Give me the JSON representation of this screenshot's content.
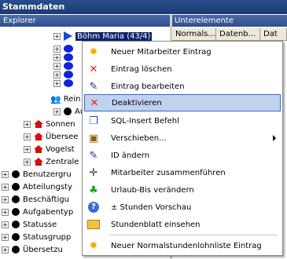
{
  "window": {
    "title": "Stammdaten"
  },
  "explorer": {
    "header": "Explorer"
  },
  "unterelemente": {
    "header": "Unterelemente",
    "columns": [
      "Normals...",
      "Datenb...",
      "Dat"
    ]
  },
  "tree": {
    "selected_employee": "Böhm Maria (43/4)",
    "partial_items": [
      "Rein",
      "Aufg"
    ],
    "departments": [
      "Sonnen",
      "Übersee",
      "Vogelst",
      "Zentrale"
    ],
    "categories": [
      "Benutzergru",
      "Abteilungsty",
      "Beschäftigu",
      "Aufgabentyp",
      "Statusse",
      "Statusgrupp",
      "Übersetzu"
    ]
  },
  "context_menu": {
    "items": [
      {
        "label": "Neuer Mitarbeiter Eintrag",
        "icon": "sun-icon"
      },
      {
        "label": "Eintrag löschen",
        "icon": "red-x-icon"
      },
      {
        "label": "Eintrag bearbeiten",
        "icon": "edit-pen-icon"
      },
      {
        "label": "Deaktivieren",
        "icon": "red-x-icon",
        "highlighted": true
      },
      {
        "label": "SQL-Insert Befehl",
        "icon": "sql-copy-icon"
      },
      {
        "label": "Verschieben...",
        "icon": "move-icon",
        "submenu": true
      },
      {
        "label": "ID ändern",
        "icon": "edit-pen-icon"
      },
      {
        "label": "Mitarbeiter zusammenführen",
        "icon": "merge-icon"
      },
      {
        "label": "Urlaub-Bis verändern",
        "icon": "palm-icon"
      },
      {
        "label": "± Stunden Vorschau",
        "icon": "question-icon"
      },
      {
        "label": "Stundenblatt einsehen",
        "icon": "folder-icon"
      },
      {
        "label": "Neuer Normalstundenlohnliste Eintrag",
        "icon": "sun-icon"
      }
    ]
  },
  "colors": {
    "highlight_bg": "#c1d2ee",
    "highlight_border": "#316ac5",
    "header_blue": "#2f4f8c"
  }
}
